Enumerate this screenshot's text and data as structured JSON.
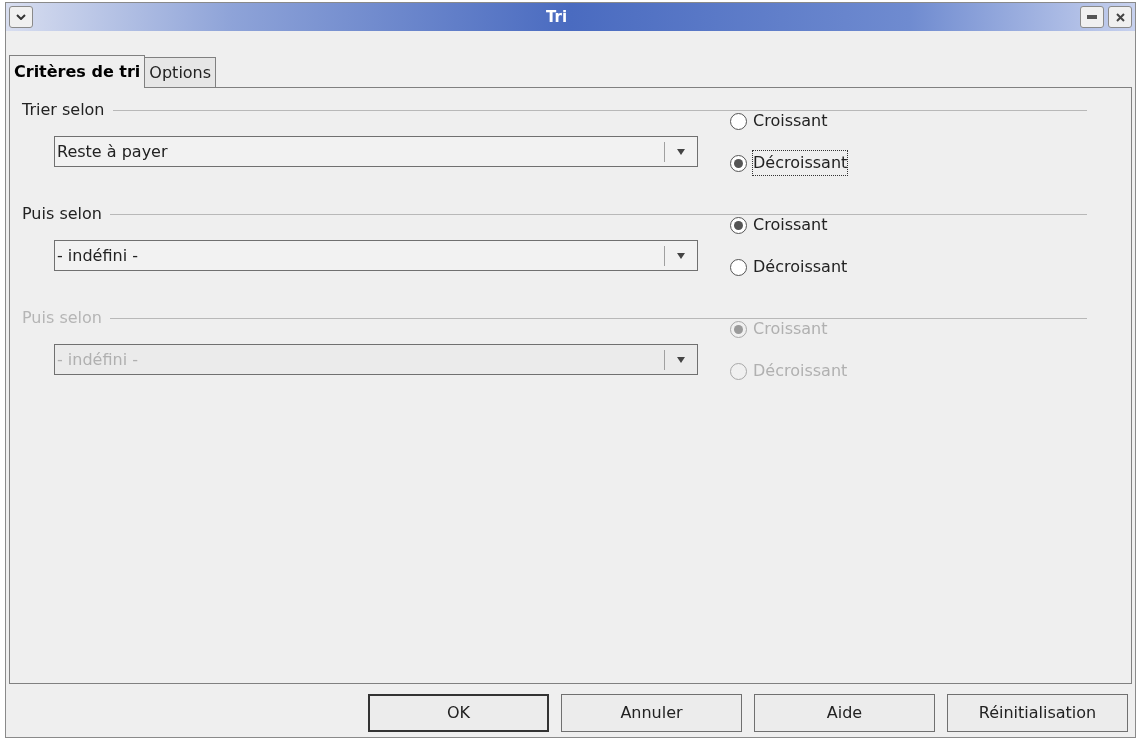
{
  "window": {
    "title": "Tri"
  },
  "tabs": [
    {
      "label": "Critères de tri",
      "selected": true
    },
    {
      "label": "Options",
      "selected": false
    }
  ],
  "sections": [
    {
      "label": "Trier selon",
      "disabled": false,
      "value": "Reste à payer",
      "radios": [
        {
          "label": "Croissant",
          "selected": false,
          "focused": false
        },
        {
          "label": "Décroissant",
          "selected": true,
          "focused": true
        }
      ]
    },
    {
      "label": "Puis selon",
      "disabled": false,
      "value": "- indéfini -",
      "radios": [
        {
          "label": "Croissant",
          "selected": true,
          "focused": false
        },
        {
          "label": "Décroissant",
          "selected": false,
          "focused": false
        }
      ]
    },
    {
      "label": "Puis selon",
      "disabled": true,
      "value": "- indéfini -",
      "radios": [
        {
          "label": "Croissant",
          "selected": true,
          "focused": false
        },
        {
          "label": "Décroissant",
          "selected": false,
          "focused": false
        }
      ]
    }
  ],
  "buttons": [
    {
      "label": "OK",
      "default": true
    },
    {
      "label": "Annuler",
      "default": false
    },
    {
      "label": "Aide",
      "default": false
    },
    {
      "label": "Réinitialisation",
      "default": false
    }
  ]
}
